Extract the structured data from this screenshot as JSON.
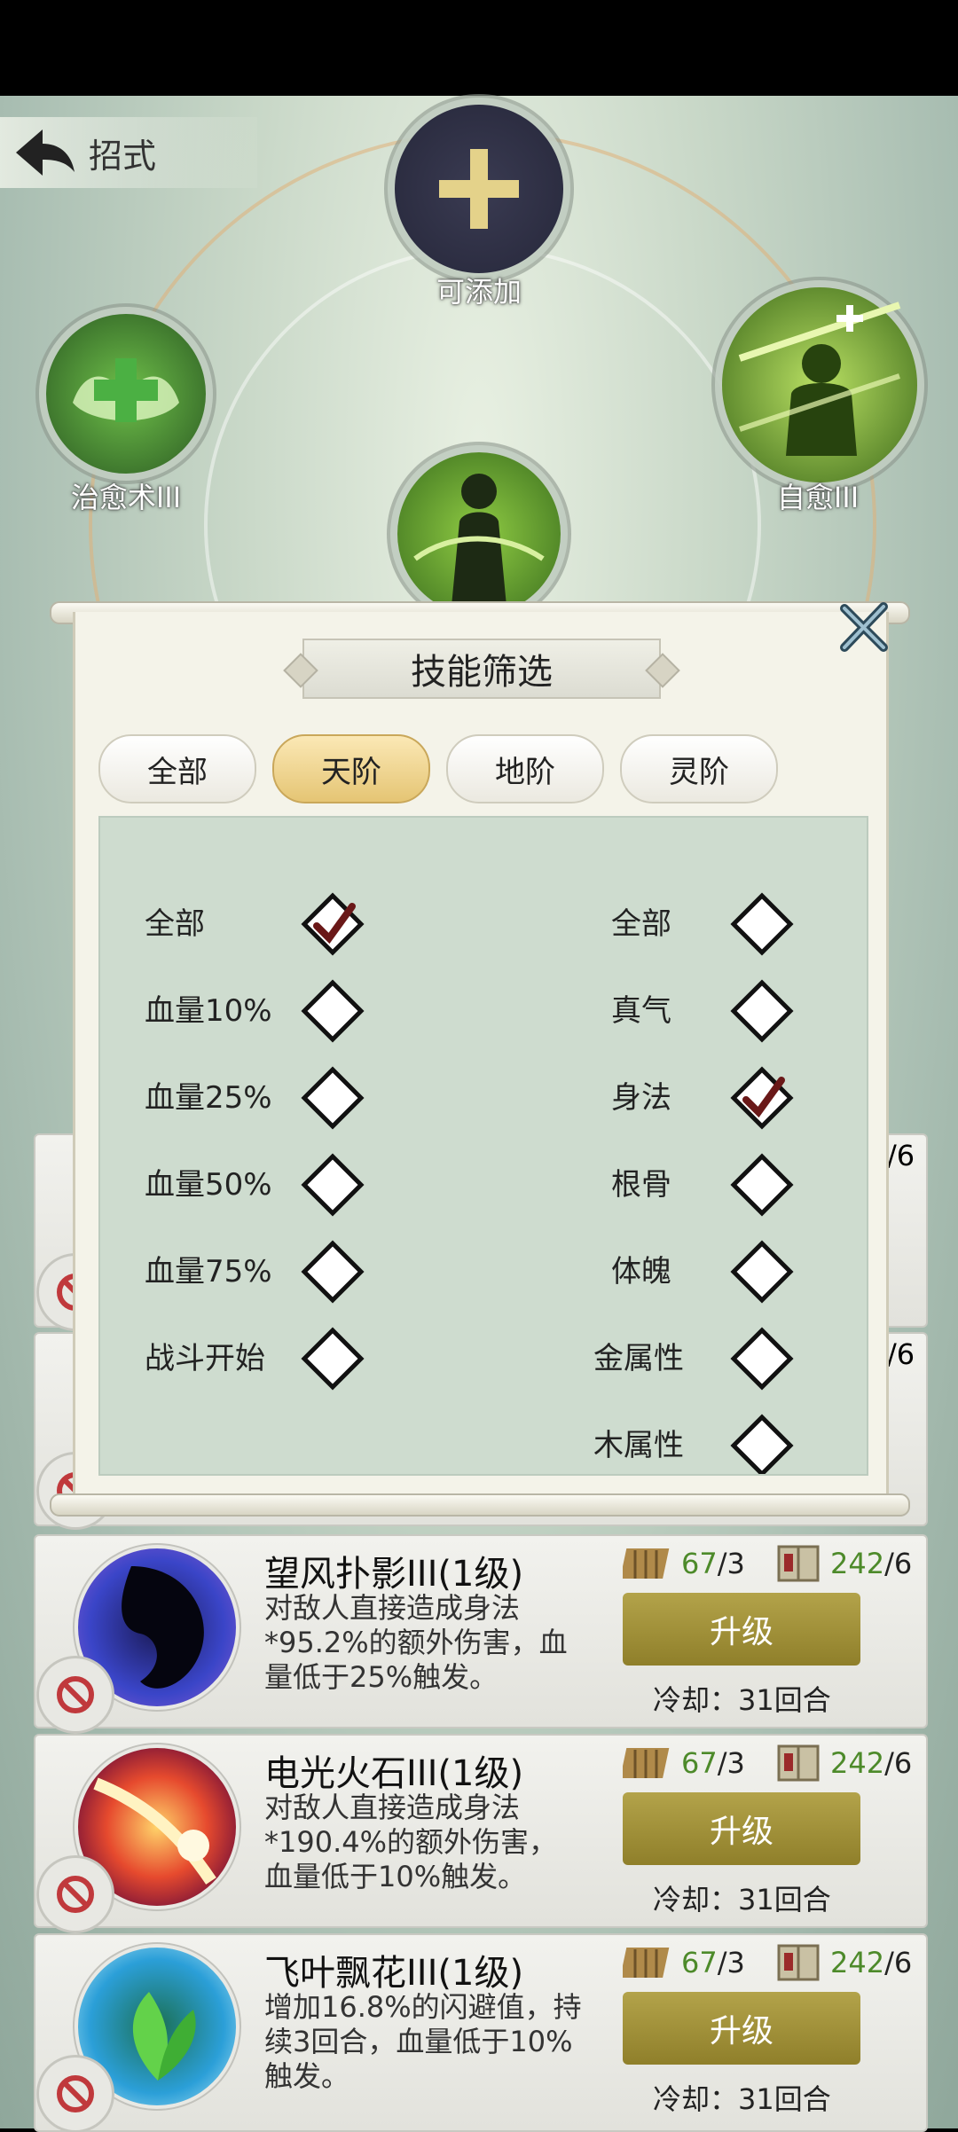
{
  "header": {
    "title": "招式"
  },
  "slots": {
    "top": {
      "label": "可添加"
    },
    "left": {
      "label": "治愈术III"
    },
    "right": {
      "label": "自愈III"
    }
  },
  "modal": {
    "title": "技能筛选",
    "tabs": [
      {
        "label": "全部",
        "active": false
      },
      {
        "label": "天阶",
        "active": true
      },
      {
        "label": "地阶",
        "active": false
      },
      {
        "label": "灵阶",
        "active": false
      }
    ],
    "left_options": [
      {
        "label": "全部",
        "checked": true
      },
      {
        "label": "血量10%",
        "checked": false
      },
      {
        "label": "血量25%",
        "checked": false
      },
      {
        "label": "血量50%",
        "checked": false
      },
      {
        "label": "血量75%",
        "checked": false
      },
      {
        "label": "战斗开始",
        "checked": false
      }
    ],
    "right_options": [
      {
        "label": "全部",
        "checked": false
      },
      {
        "label": "真气",
        "checked": false
      },
      {
        "label": "身法",
        "checked": true
      },
      {
        "label": "根骨",
        "checked": false
      },
      {
        "label": "体魄",
        "checked": false
      },
      {
        "label": "金属性",
        "checked": false
      },
      {
        "label": "木属性",
        "checked": false
      }
    ]
  },
  "skills": [
    {
      "name": "望风扑影III(1级)",
      "desc": "对敌人直接造成身法*95.2%的额外伤害，血量低于25%触发。",
      "res1": "67",
      "res1_max": "/3",
      "res2": "242",
      "res2_max": "/6",
      "upgrade": "升级",
      "cooldown": "冷却：31回合"
    },
    {
      "name": "电光火石III(1级)",
      "desc": "对敌人直接造成身法*190.4%的额外伤害，血量低于10%触发。",
      "res1": "67",
      "res1_max": "/3",
      "res2": "242",
      "res2_max": "/6",
      "upgrade": "升级",
      "cooldown": "冷却：31回合"
    },
    {
      "name": "飞叶飘花III(1级)",
      "desc": "增加16.8%的闪避值，持续3回合，血量低于10%触发。",
      "res1": "67",
      "res1_max": "/3",
      "res2": "242",
      "res2_max": "/6",
      "upgrade": "升级",
      "cooldown": "冷却：31回合"
    }
  ],
  "partial_list": {
    "count1": "/6",
    "count2": "/6"
  },
  "colors": {
    "accent_gold": "#b3a34a",
    "tab_active": "#e5c574",
    "value_green": "#4d8a2a",
    "check_mark": "#6a1818"
  }
}
